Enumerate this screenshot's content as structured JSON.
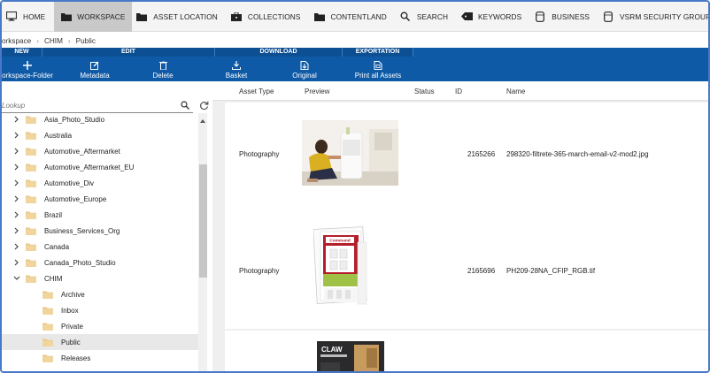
{
  "nav": {
    "items": [
      {
        "label": "HOME",
        "icon": "monitor-icon"
      },
      {
        "label": "WORKSPACE",
        "icon": "folder-icon",
        "active": true
      },
      {
        "label": "ASSET LOCATION",
        "icon": "folder-icon"
      },
      {
        "label": "COLLECTIONS",
        "icon": "briefcase-icon"
      },
      {
        "label": "CONTENTLAND",
        "icon": "folder-icon"
      },
      {
        "label": "SEARCH",
        "icon": "search-icon"
      },
      {
        "label": "KEYWORDS",
        "icon": "tag-icon"
      },
      {
        "label": "BUSINESS",
        "icon": "database-icon"
      },
      {
        "label": "VSRM SECURITY GROUPS",
        "icon": "database-icon"
      }
    ]
  },
  "breadcrumb": [
    "orkspace",
    "CHIM",
    "Public"
  ],
  "toolbar": {
    "groups": {
      "new": "NEW",
      "edit": "EDIT",
      "download": "DOWNLOAD",
      "exportation": "EXPORTATION"
    },
    "buttons": {
      "workspace_folder": "orkspace-Folder",
      "metadata": "Metadata",
      "delete": "Delete",
      "basket": "Basket",
      "original": "Original",
      "print_all": "Print all Assets"
    },
    "accent_color": "#0f5aa6"
  },
  "lookup": {
    "placeholder": "Lookup"
  },
  "tree": [
    {
      "label": "Asia_Photo_Studio",
      "level": 0,
      "expanded": false
    },
    {
      "label": "Australia",
      "level": 0,
      "expanded": false
    },
    {
      "label": "Automotive_Aftermarket",
      "level": 0,
      "expanded": false
    },
    {
      "label": "Automotive_Aftermarket_EU",
      "level": 0,
      "expanded": false
    },
    {
      "label": "Automotive_Div",
      "level": 0,
      "expanded": false
    },
    {
      "label": "Automotive_Europe",
      "level": 0,
      "expanded": false
    },
    {
      "label": "Brazil",
      "level": 0,
      "expanded": false
    },
    {
      "label": "Business_Services_Org",
      "level": 0,
      "expanded": false
    },
    {
      "label": "Canada",
      "level": 0,
      "expanded": false
    },
    {
      "label": "Canada_Photo_Studio",
      "level": 0,
      "expanded": false
    },
    {
      "label": "CHIM",
      "level": 0,
      "expanded": true
    },
    {
      "label": "Archive",
      "level": 1
    },
    {
      "label": "Inbox",
      "level": 1
    },
    {
      "label": "Private",
      "level": 1
    },
    {
      "label": "Public",
      "level": 1,
      "selected": true
    },
    {
      "label": "Releases",
      "level": 1
    }
  ],
  "table": {
    "headers": {
      "asset_type": "Asset Type",
      "preview": "Preview",
      "status": "Status",
      "id": "ID",
      "name": "Name"
    },
    "rows": [
      {
        "asset_type": "Photography",
        "status": "",
        "id": "2165266",
        "name": "298320-filtrete-365-march-email-v2-mod2.jpg"
      },
      {
        "asset_type": "Photography",
        "status": "",
        "id": "2165696",
        "name": "PH209-28NA_CFIP_RGB.tif"
      },
      {
        "asset_type": "",
        "status": "",
        "id": "",
        "name": ""
      }
    ]
  },
  "package_text": {
    "brand": "Command",
    "claw": "CLAW"
  }
}
